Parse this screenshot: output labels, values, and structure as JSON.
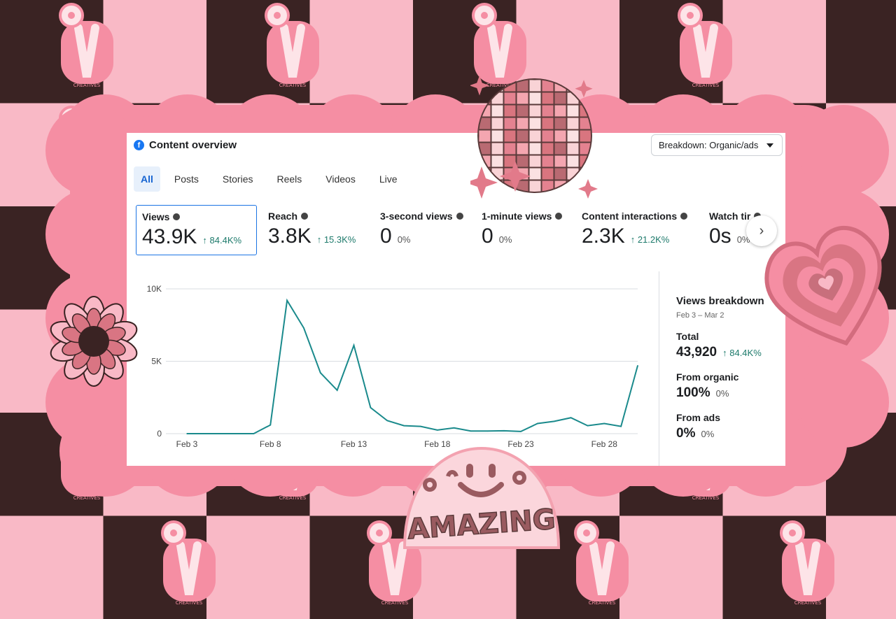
{
  "header": {
    "icon": "facebook-icon",
    "title": "Content overview",
    "breakdown_label": "Breakdown: Organic/ads"
  },
  "tabs": [
    {
      "label": "All",
      "active": true
    },
    {
      "label": "Posts"
    },
    {
      "label": "Stories"
    },
    {
      "label": "Reels"
    },
    {
      "label": "Videos"
    },
    {
      "label": "Live"
    }
  ],
  "metrics": [
    {
      "label": "Views",
      "value": "43.9K",
      "delta": "↑ 84.4K%"
    },
    {
      "label": "Reach",
      "value": "3.8K",
      "delta": "↑ 15.3K%"
    },
    {
      "label": "3-second views",
      "value": "0",
      "delta": "0%"
    },
    {
      "label": "1-minute views",
      "value": "0",
      "delta": "0%"
    },
    {
      "label": "Content interactions",
      "value": "2.3K",
      "delta": "↑ 21.2K%"
    },
    {
      "label": "Watch tir",
      "value": "0s",
      "delta": "0%"
    }
  ],
  "breakdown": {
    "title": "Views breakdown",
    "date_range": "Feb 3 – Mar 2",
    "total_label": "Total",
    "total_value": "43,920",
    "total_delta": "↑ 84.4K%",
    "organic_label": "From organic",
    "organic_value": "100%",
    "organic_delta": "0%",
    "ads_label": "From ads",
    "ads_value": "0%",
    "ads_delta": "0%"
  },
  "stickers": {
    "amazing": "AMAZING",
    "brand": "CREATIVES"
  },
  "colors": {
    "line": "#1a8a8c",
    "accent": "#1b74e4",
    "frame": "#f58ea3",
    "dark": "#3a2323",
    "light": "#f9b9c6"
  },
  "chart_data": {
    "type": "line",
    "x": [
      "Feb 3",
      "Feb 4",
      "Feb 5",
      "Feb 6",
      "Feb 7",
      "Feb 8",
      "Feb 9",
      "Feb 10",
      "Feb 11",
      "Feb 12",
      "Feb 13",
      "Feb 14",
      "Feb 15",
      "Feb 16",
      "Feb 17",
      "Feb 18",
      "Feb 19",
      "Feb 20",
      "Feb 21",
      "Feb 22",
      "Feb 23",
      "Feb 24",
      "Feb 25",
      "Feb 26",
      "Feb 27",
      "Feb 28",
      "Mar 1",
      "Mar 2"
    ],
    "values": [
      0,
      0,
      0,
      0,
      0,
      600,
      9200,
      7300,
      4200,
      3000,
      6100,
      1800,
      900,
      550,
      500,
      250,
      400,
      180,
      180,
      200,
      150,
      700,
      850,
      1100,
      550,
      700,
      500,
      4700
    ],
    "xticks": [
      "Feb 3",
      "Feb 8",
      "Feb 13",
      "Feb 18",
      "Feb 23",
      "Feb 28"
    ],
    "yticks": [
      "0",
      "5K",
      "10K"
    ],
    "ylim": [
      0,
      10000
    ],
    "grid": true
  }
}
